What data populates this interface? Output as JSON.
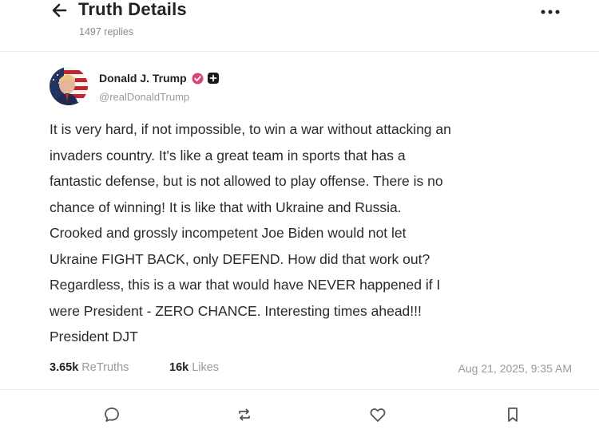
{
  "header": {
    "title": "Truth Details",
    "replies": "1497 replies"
  },
  "post": {
    "author_name": "Donald J. Trump",
    "handle": "@realDonaldTrump",
    "text": "It is very hard, if not impossible, to win a war without attacking an\ninvaders country. It's like a great team in sports that has a\nfantastic defense, but is not allowed to play offense. There is no\nchance of winning! It is like that with Ukraine and Russia.\nCrooked and grossly incompetent Joe Biden would not let\nUkraine FIGHT BACK, only DEFEND. How did that work out?\nRegardless, this is a war that would have NEVER happened if I\nwere President - ZERO CHANCE. Interesting times ahead!!!\nPresident DJT",
    "retruths_count": "3.65k",
    "retruths_label": "ReTruths",
    "likes_count": "16k",
    "likes_label": "Likes",
    "timestamp": "Aug 21, 2025, 9:35 AM"
  },
  "icons": {
    "back": "arrow-left-icon",
    "more": "more-horizontal-icon",
    "verified": "verified-badge-icon",
    "plus": "plus-square-icon",
    "reply": "comment-icon",
    "retruth": "retruth-icon",
    "like": "heart-icon",
    "bookmark": "bookmark-icon"
  },
  "colors": {
    "verified_badge": "#d8457a",
    "text_primary": "#222222",
    "text_secondary": "#9a9a9a"
  }
}
